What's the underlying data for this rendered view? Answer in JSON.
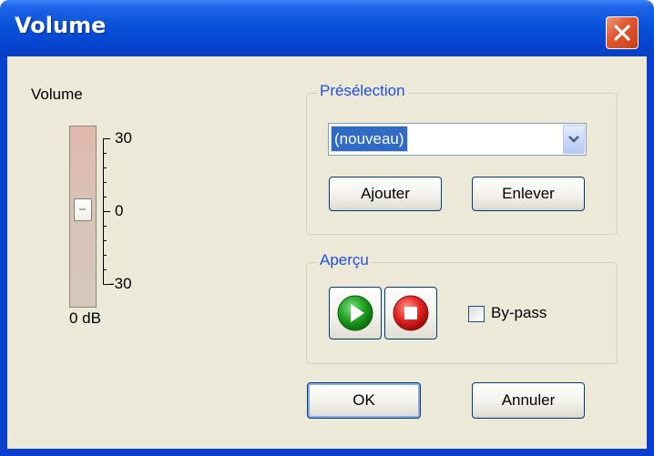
{
  "window": {
    "title": "Volume"
  },
  "volume": {
    "label": "Volume",
    "scale_top": "30",
    "scale_mid": "0",
    "scale_bottom": "-30",
    "value_readout": "0 dB",
    "level_db": 0
  },
  "preset": {
    "legend": "Présélection",
    "selected": "(nouveau)",
    "add_label": "Ajouter",
    "remove_label": "Enlever"
  },
  "preview": {
    "legend": "Aperçu",
    "bypass_label": "By-pass",
    "bypass_checked": false
  },
  "footer": {
    "ok_label": "OK",
    "cancel_label": "Annuler"
  },
  "colors": {
    "titlebar": "#0a52db",
    "legend_text": "#1f4fe0",
    "dialog_bg": "#ece9d8",
    "close_button": "#e2582f",
    "play_green": "#1f9e1f",
    "stop_red": "#e02020"
  },
  "icons": {
    "close": "close-icon",
    "play": "play-icon",
    "stop": "stop-icon",
    "dropdown": "chevron-down-icon"
  }
}
